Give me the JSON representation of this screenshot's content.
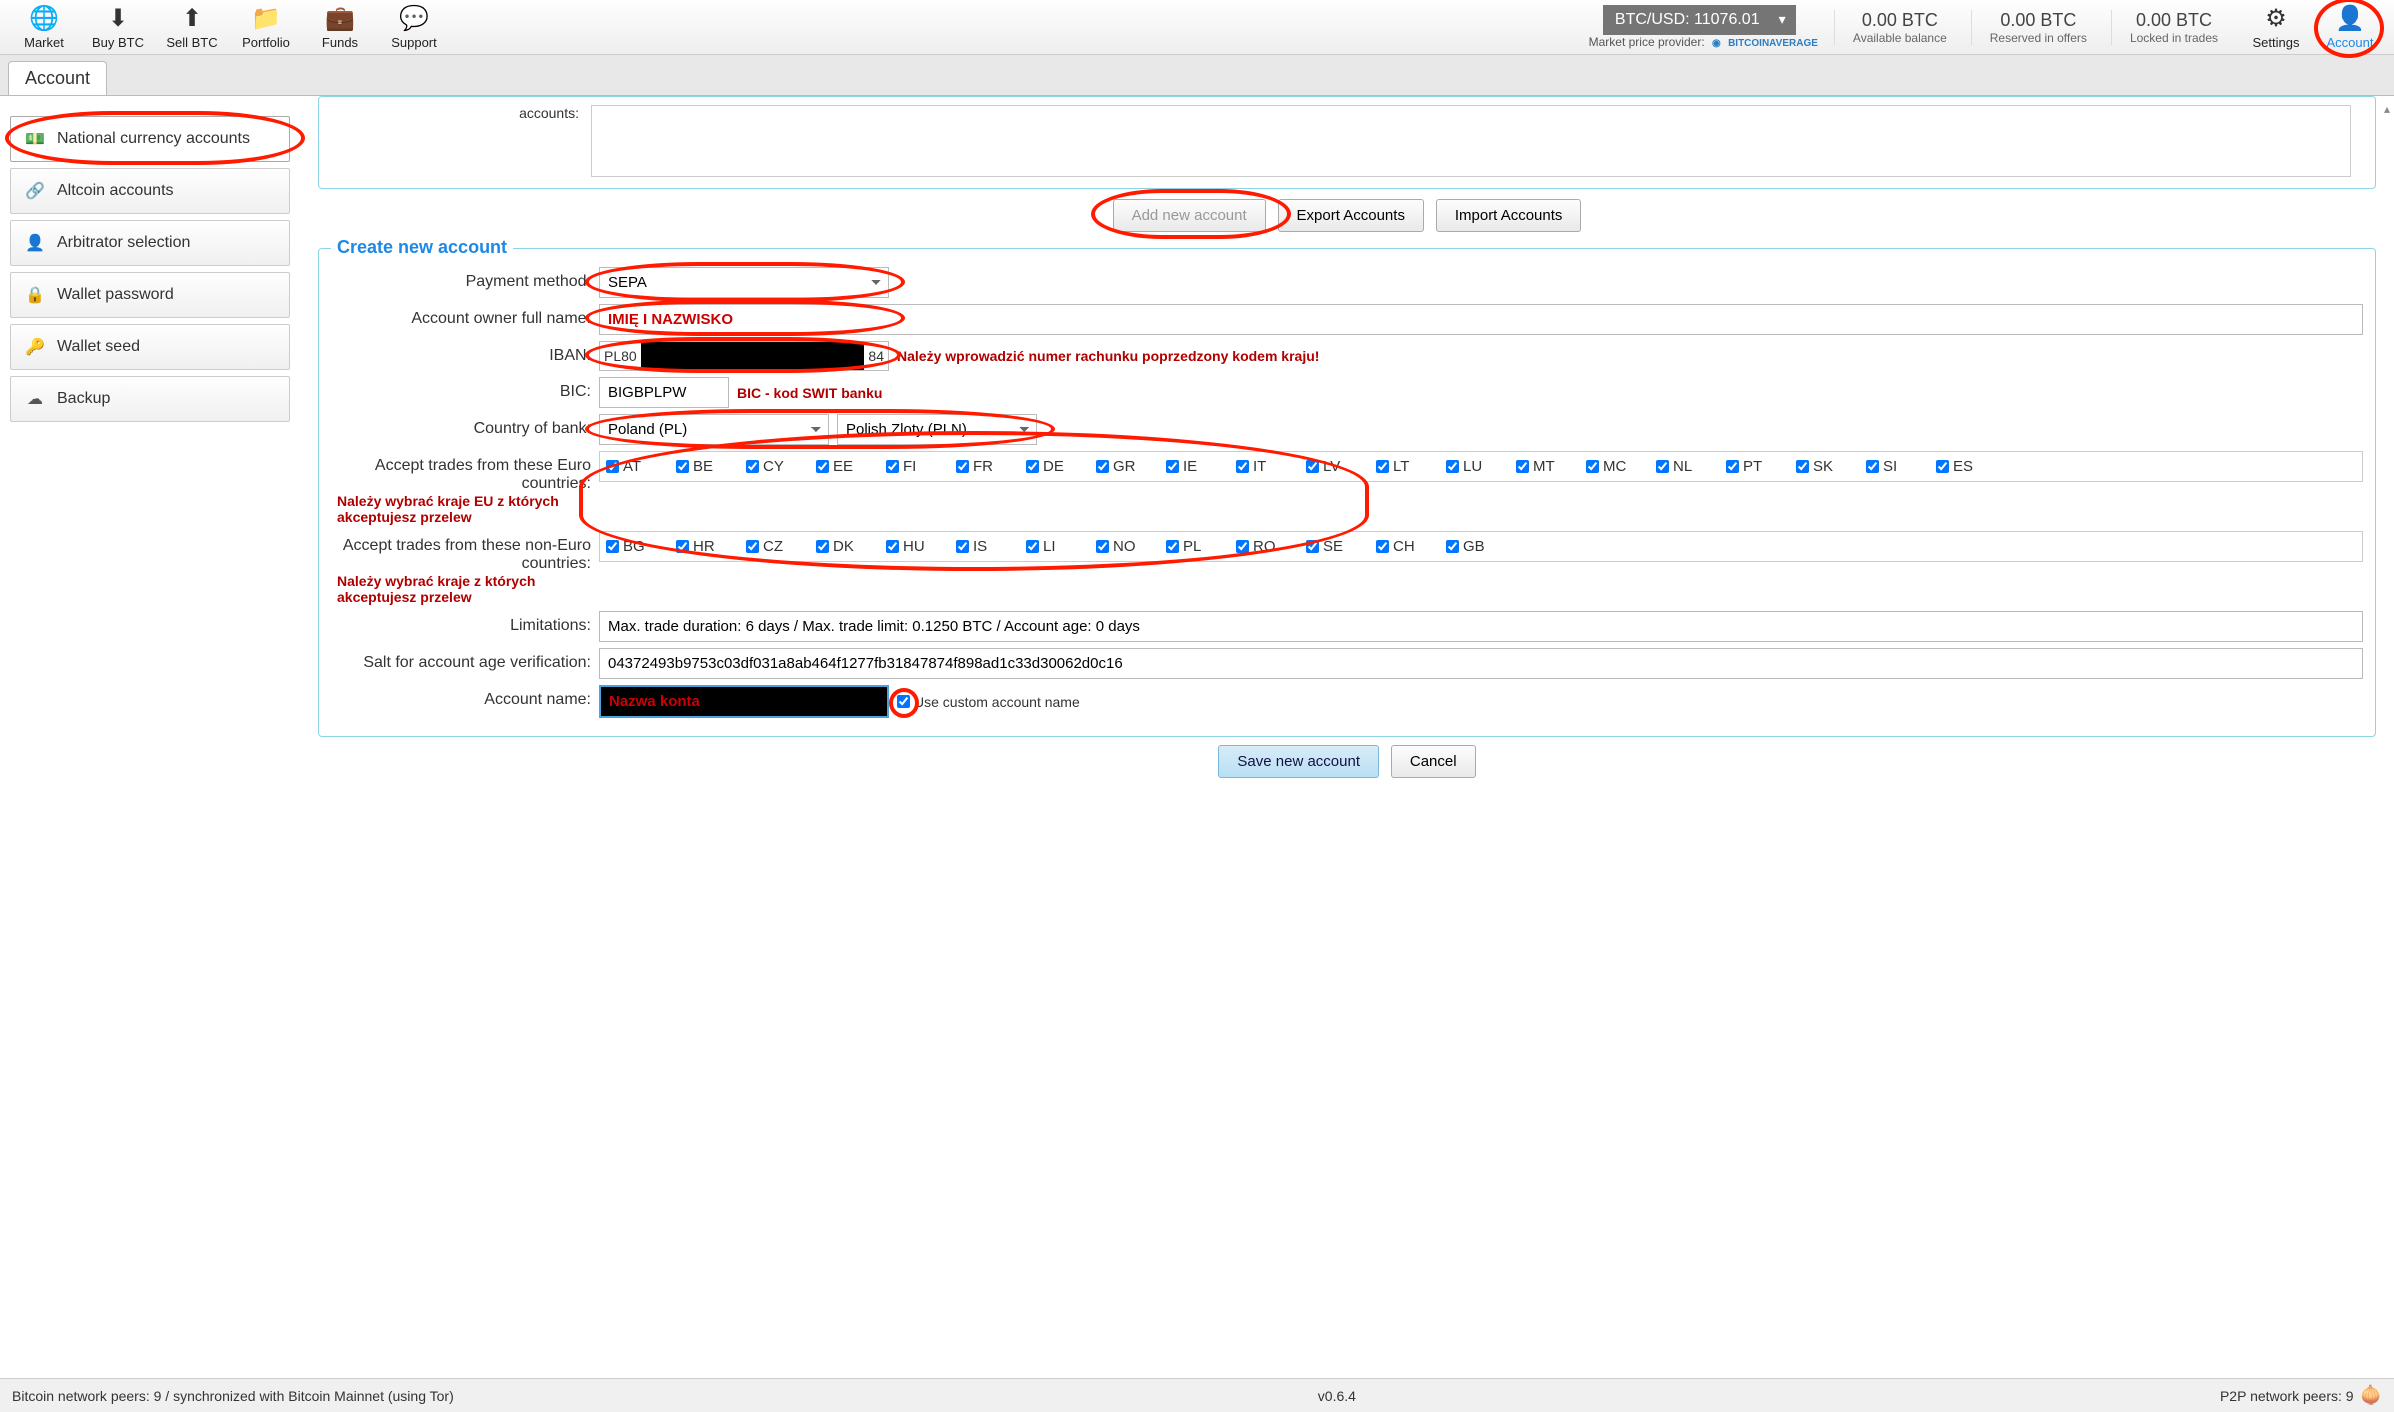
{
  "toolbar": {
    "market": "Market",
    "buy": "Buy BTC",
    "sell": "Sell BTC",
    "portfolio": "Portfolio",
    "funds": "Funds",
    "support": "Support",
    "price": "BTC/USD: 11076.01",
    "provider_label": "Market price provider:",
    "provider_name": "BITCOINAVERAGE",
    "balances": [
      {
        "value": "0.00 BTC",
        "label": "Available balance"
      },
      {
        "value": "0.00 BTC",
        "label": "Reserved in offers"
      },
      {
        "value": "0.00 BTC",
        "label": "Locked in trades"
      }
    ],
    "settings": "Settings",
    "account": "Account"
  },
  "tab": "Account",
  "sidebar": [
    {
      "icon": "💵",
      "label": "National currency accounts"
    },
    {
      "icon": "🔗",
      "label": "Altcoin accounts"
    },
    {
      "icon": "👤",
      "label": "Arbitrator selection"
    },
    {
      "icon": "🔒",
      "label": "Wallet password"
    },
    {
      "icon": "🔑",
      "label": "Wallet seed"
    },
    {
      "icon": "☁",
      "label": "Backup"
    }
  ],
  "accounts_label": "accounts:",
  "buttons": {
    "add": "Add new account",
    "export": "Export Accounts",
    "import": "Import Accounts",
    "save": "Save new account",
    "cancel": "Cancel"
  },
  "form": {
    "title": "Create new account",
    "labels": {
      "method": "Payment method:",
      "owner": "Account owner full name:",
      "iban": "IBAN:",
      "bic": "BIC:",
      "country": "Country of bank:",
      "euro": "Accept trades from these Euro countries:",
      "noneuro": "Accept trades from these non-Euro countries:",
      "limitations": "Limitations:",
      "salt": "Salt for account age verification:",
      "account_name": "Account name:",
      "custom": "Use custom account name"
    },
    "method": "SEPA",
    "owner_redacted": "IMIĘ I NAZWISKO",
    "iban_prefix": "PL80",
    "iban_suffix": "84",
    "iban_note": "Należy wprowadzić numer rachunku poprzedzony kodem kraju!",
    "bic": "BIGBPLPW",
    "bic_note": "BIC - kod SWIT banku",
    "country": "Poland (PL)",
    "currency": "Polish Zloty (PLN)",
    "euro_note": "Należy wybrać kraje EU z których akceptujesz przelew",
    "noneuro_note": "Należy wybrać kraje z których akceptujesz przelew",
    "euro_countries": [
      "AT",
      "BE",
      "CY",
      "EE",
      "FI",
      "FR",
      "DE",
      "GR",
      "IE",
      "IT",
      "LV",
      "LT",
      "LU",
      "MT",
      "MC",
      "NL",
      "PT",
      "SK",
      "SI",
      "ES"
    ],
    "noneuro_countries": [
      "BG",
      "HR",
      "CZ",
      "DK",
      "HU",
      "IS",
      "LI",
      "NO",
      "PL",
      "RO",
      "SE",
      "CH",
      "GB"
    ],
    "limitations": "Max. trade duration: 6 days / Max. trade limit: 0.1250 BTC / Account age: 0 days",
    "salt": "04372493b9753c03df031a8ab464f1277fb31847874f898ad1c33d30062d0c16",
    "account_name_redacted": "Nazwa konta"
  },
  "status": {
    "left": "Bitcoin network peers: 9 / synchronized with Bitcoin Mainnet (using Tor)",
    "center": "v0.6.4",
    "right": "P2P network peers: 9"
  }
}
